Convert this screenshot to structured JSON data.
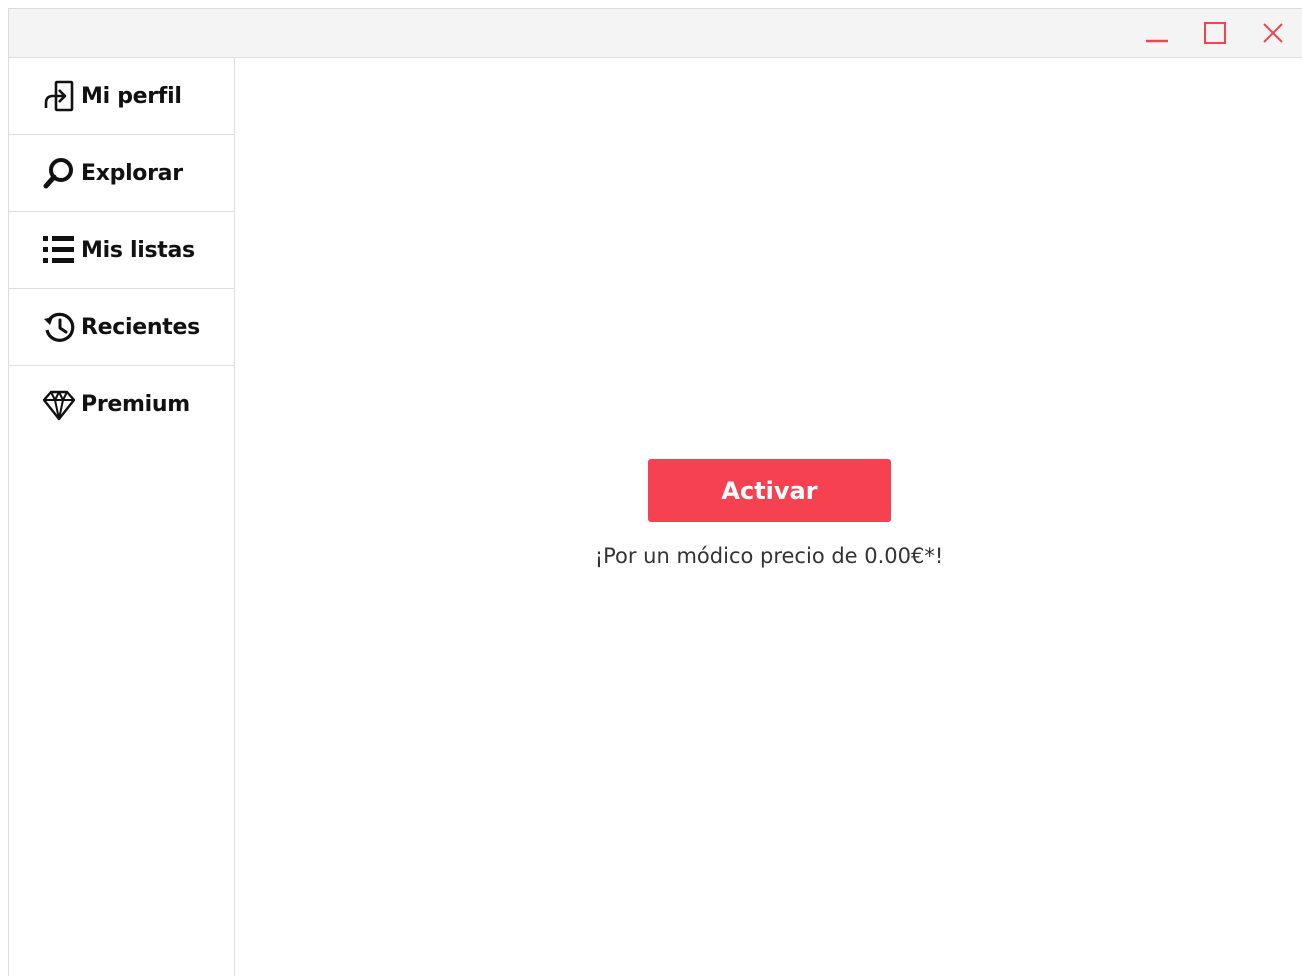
{
  "window": {
    "controls": [
      {
        "name": "minimize-icon",
        "label": "minimize"
      },
      {
        "name": "maximize-icon",
        "label": "maximize"
      },
      {
        "name": "close-icon",
        "label": "close"
      }
    ],
    "accent": "#f64250"
  },
  "sidebar": {
    "items": [
      {
        "label": "Mi perfil",
        "icon": "login-icon"
      },
      {
        "label": "Explorar",
        "icon": "search-icon"
      },
      {
        "label": "Mis listas",
        "icon": "list-icon"
      },
      {
        "label": "Recientes",
        "icon": "history-icon"
      },
      {
        "label": "Premium",
        "icon": "diamond-icon"
      }
    ]
  },
  "main": {
    "activate_label": "Activar",
    "price_note": "¡Por un módico precio de 0.00€*!"
  }
}
